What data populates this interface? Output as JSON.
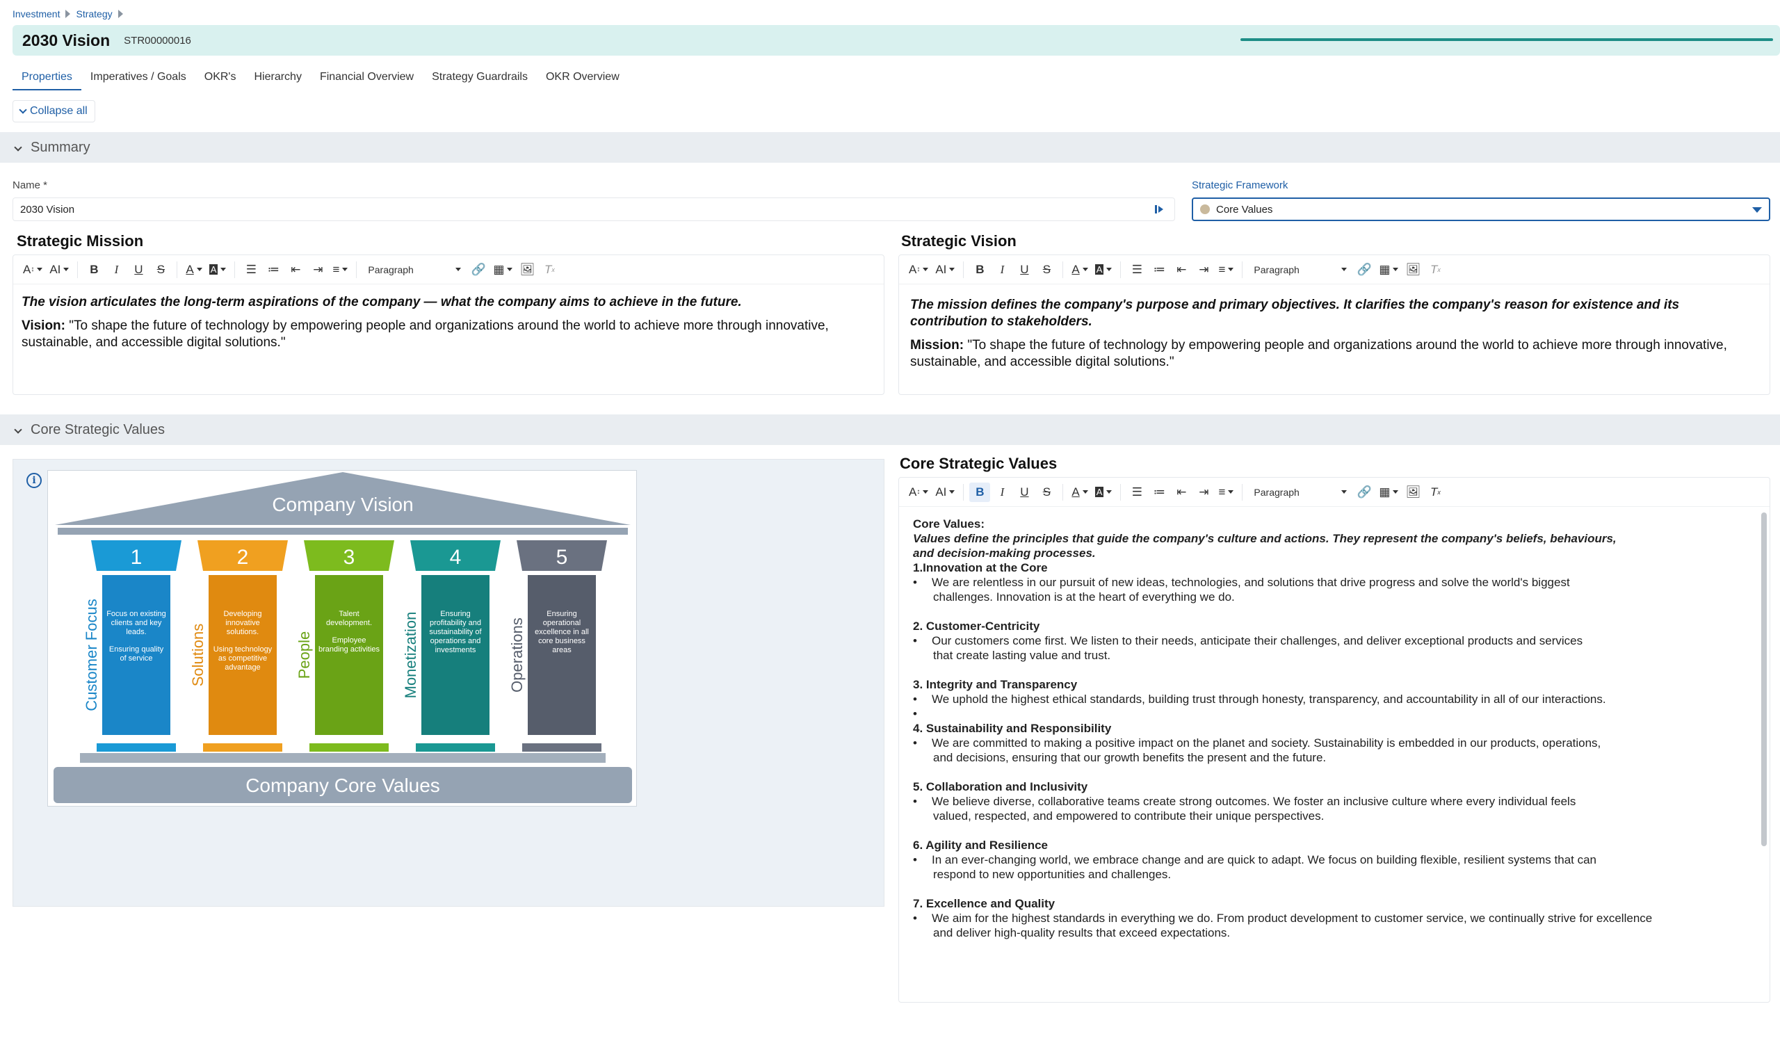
{
  "breadcrumb": [
    "Investment",
    "Strategy"
  ],
  "header": {
    "title": "2030 Vision",
    "code": "STR00000016"
  },
  "tabs": [
    "Properties",
    "Imperatives / Goals",
    "OKR's",
    "Hierarchy",
    "Financial Overview",
    "Strategy Guardrails",
    "OKR Overview"
  ],
  "collapse_all": "Collapse all",
  "sections": {
    "summary": "Summary",
    "core": "Core Strategic Values"
  },
  "fields": {
    "name_label": "Name *",
    "name_value": "2030 Vision",
    "framework_label": "Strategic Framework",
    "framework_value": "Core Values"
  },
  "toolbar": {
    "paragraph": "Paragraph"
  },
  "mission": {
    "title": "Strategic Mission",
    "intro": "The vision articulates the long-term aspirations of the company — what the company aims to achieve in the future.",
    "label": "Vision:",
    "text": " \"To shape the future of technology by empowering people and organizations around the world to achieve more through innovative, sustainable, and accessible digital solutions.\""
  },
  "vision": {
    "title": "Strategic Vision",
    "intro": "The mission defines the company's purpose and primary objectives. It clarifies the company's reason for existence and its contribution to stakeholders.",
    "label": "Mission:",
    "text": " \"To shape the future of technology by empowering people and organizations around the world to achieve more through innovative, sustainable, and accessible digital solutions.\""
  },
  "temple": {
    "roof": "Company Vision",
    "base": "Company Core Values",
    "pillars": [
      {
        "num": "1",
        "side": "Customer Focus",
        "text1": "Focus on existing clients and key leads.",
        "text2": "Ensuring quality of service",
        "color": "#1a86c8",
        "cap": "#1a9ad6"
      },
      {
        "num": "2",
        "side": "Solutions",
        "text1": "Developing innovative solutions.",
        "text2": "Using technology as competitive advantage",
        "color": "#e08a10",
        "cap": "#f0a020"
      },
      {
        "num": "3",
        "side": "People",
        "text1": "Talent development.",
        "text2": "Employee branding activities",
        "color": "#6aa316",
        "cap": "#7dbb1e"
      },
      {
        "num": "4",
        "side": "Monetization",
        "text1": "Ensuring profitability and sustainability of operations and investments",
        "text2": "",
        "color": "#167f7c",
        "cap": "#1a9893"
      },
      {
        "num": "5",
        "side": "Operations",
        "text1": "Ensuring operational excellence in all core business areas",
        "text2": "",
        "color": "#565d6b",
        "cap": "#6a7180"
      }
    ]
  },
  "core_values": {
    "title": "Core Strategic Values",
    "heading": "Core Values:",
    "intro": "Values define the principles that guide the company's culture and actions. They represent the company's beliefs, behaviours, and decision-making processes.",
    "items": [
      {
        "title": "1.Innovation at the Core",
        "b1": "We are relentless in our pursuit of new ideas, technologies, and solutions that drive progress and solve the world's biggest",
        "b2": "challenges. Innovation is at the heart of everything we do."
      },
      {
        "title": "2. Customer-Centricity",
        "b1": "Our customers come first. We listen to their needs, anticipate their challenges, and deliver exceptional products and services",
        "b2": "that create lasting value and trust."
      },
      {
        "title": "3. Integrity and Transparency",
        "b1": "We uphold the highest ethical standards, building trust through honesty, transparency, and accountability in all of our interactions.",
        "b2": ""
      },
      {
        "title": "4. Sustainability and Responsibility",
        "b1": "We are committed to making a positive impact on the planet and society. Sustainability is embedded in our products, operations,",
        "b2": "and decisions, ensuring that our growth benefits the present and the future."
      },
      {
        "title": "5. Collaboration and Inclusivity",
        "b1": "We believe diverse, collaborative teams create strong outcomes. We foster an inclusive culture where every individual feels",
        "b2": "valued, respected, and empowered to contribute their unique perspectives."
      },
      {
        "title": "6. Agility and Resilience",
        "b1": "In an ever-changing world, we embrace change and are quick to adapt. We focus on building flexible, resilient systems that can",
        "b2": "respond to new opportunities and challenges."
      },
      {
        "title": "7. Excellence and Quality",
        "b1": "We aim for the highest standards in everything we do. From product development to customer service, we continually strive for excellence",
        "b2": "and deliver high-quality results that exceed expectations."
      }
    ]
  },
  "colors": {
    "accent": "#1f5fa6",
    "header_bg": "#d9f1ef",
    "progress": "#1e8e87",
    "section_bg": "#e9edf1"
  }
}
